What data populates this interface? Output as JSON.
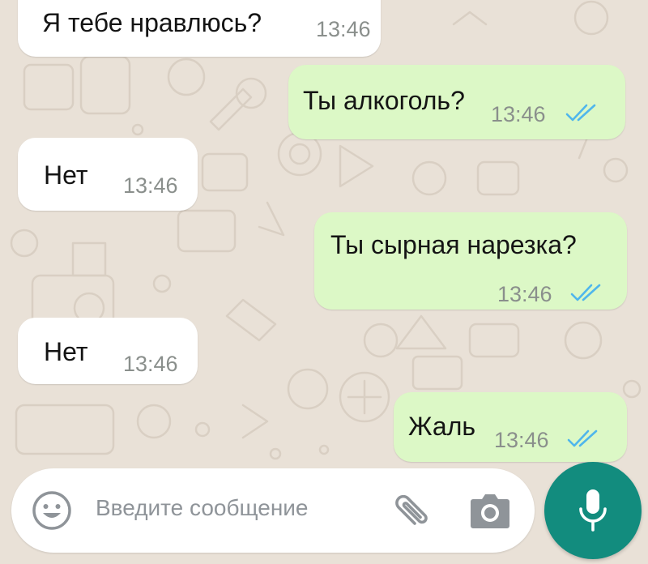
{
  "messages": [
    {
      "direction": "incoming",
      "text": "Я тебе нравлюсь?",
      "time": "13:46"
    },
    {
      "direction": "outgoing",
      "text": "Ты алкоголь?",
      "time": "13:46",
      "status": "read"
    },
    {
      "direction": "incoming",
      "text": "Нет",
      "time": "13:46"
    },
    {
      "direction": "outgoing",
      "text": "Ты сырная нарезка?",
      "time": "13:46",
      "status": "read"
    },
    {
      "direction": "incoming",
      "text": "Нет",
      "time": "13:46"
    },
    {
      "direction": "outgoing",
      "text": "Жаль",
      "time": "13:46",
      "status": "read"
    }
  ],
  "composer": {
    "placeholder": "Введите сообщение",
    "emoji_icon": "emoji-icon",
    "attach_icon": "paperclip-icon",
    "camera_icon": "camera-icon",
    "mic_icon": "microphone-icon"
  },
  "colors": {
    "wallpaper": "#e9e1d7",
    "incoming_bubble": "#ffffff",
    "outgoing_bubble": "#dcf8c6",
    "read_ticks": "#4fb6ec",
    "mic_button": "#128c7e"
  }
}
